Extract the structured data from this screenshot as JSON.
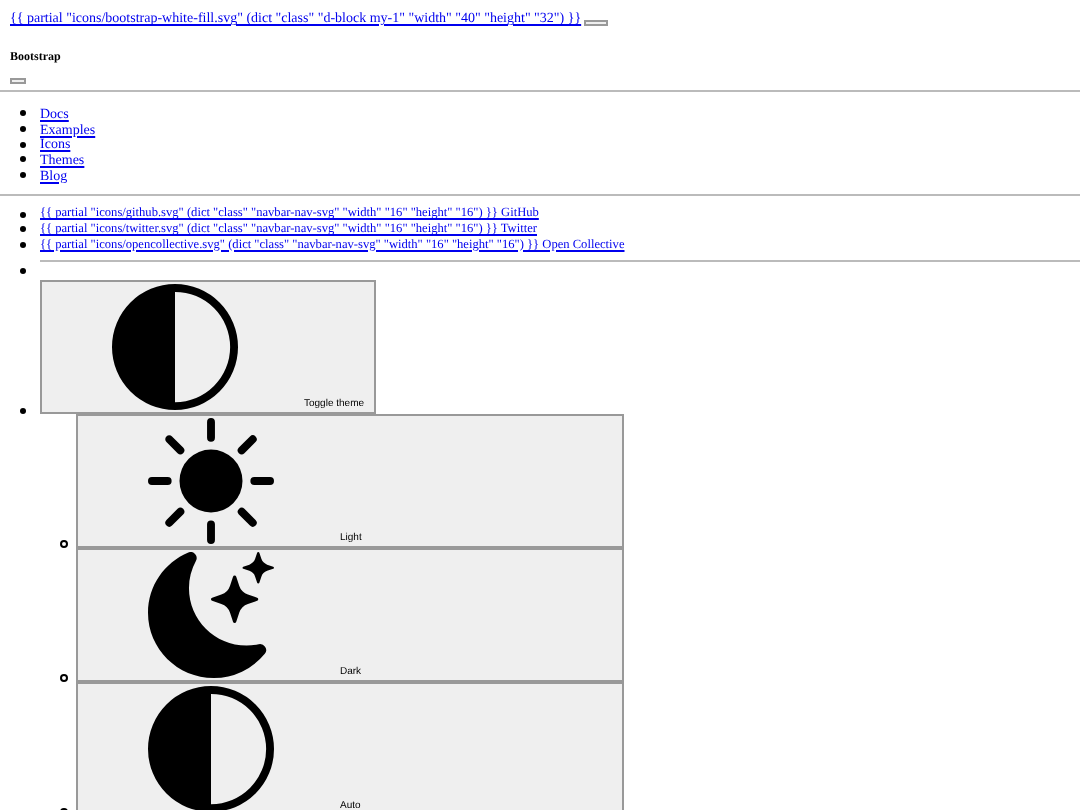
{
  "top_link": "{{ partial \"icons/bootstrap-white-fill.svg\" (dict \"class\" \"d-block my-1\" \"width\" \"40\" \"height\" \"32\") }}",
  "brand": "Bootstrap",
  "nav_links": [
    "Docs",
    "Examples",
    "Icons",
    "Themes",
    "Blog"
  ],
  "social_links": [
    "{{ partial \"icons/github.svg\" (dict \"class\" \"navbar-nav-svg\" \"width\" \"16\" \"height\" \"16\") }} GitHub",
    "{{ partial \"icons/twitter.svg\" (dict \"class\" \"navbar-nav-svg\" \"width\" \"16\" \"height\" \"16\") }} Twitter",
    "{{ partial \"icons/opencollective.svg\" (dict \"class\" \"navbar-nav-svg\" \"width\" \"16\" \"height\" \"16\") }} Open Collective"
  ],
  "theme_toggle": {
    "label": "Toggle theme"
  },
  "theme_options": [
    {
      "kind": "sun",
      "label": "Light"
    },
    {
      "kind": "moon",
      "label": "Dark"
    },
    {
      "kind": "auto",
      "label": "Auto"
    }
  ]
}
